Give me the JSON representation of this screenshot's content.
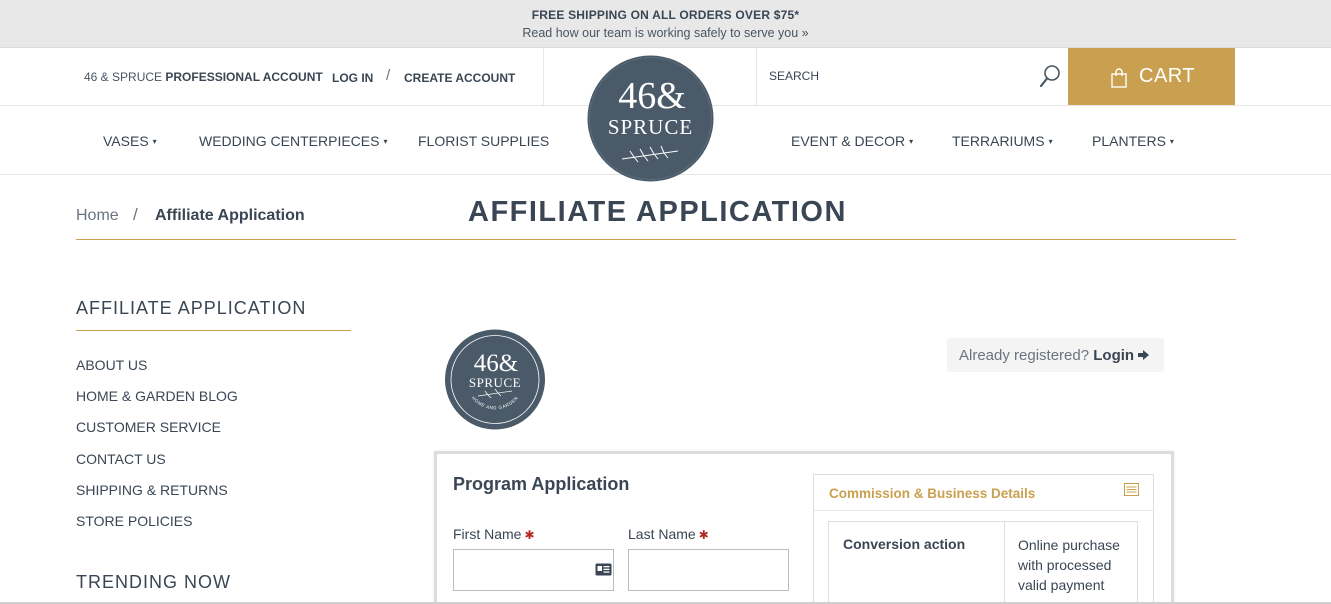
{
  "promo": {
    "line1": "FREE SHIPPING ON ALL ORDERS OVER $75*",
    "line2": "Read how our team is working safely to serve you »"
  },
  "header": {
    "account_prefix": "46 & SPRUCE",
    "account_bold": "PROFESSIONAL ACCOUNT",
    "login": "LOG IN",
    "separator": "/",
    "create_account": "CREATE ACCOUNT",
    "search_placeholder": "SEARCH",
    "cart": "CART"
  },
  "logo": {
    "line1": "46&",
    "line2": "SPRUCE",
    "ring_text": "HOME AND GARDEN"
  },
  "nav": {
    "items": [
      {
        "label": "VASES",
        "dropdown": "▾"
      },
      {
        "label": "WEDDING CENTERPIECES",
        "dropdown": "▾"
      },
      {
        "label": "FLORIST SUPPLIES",
        "dropdown": ""
      },
      {
        "label": "EVENT & DECOR",
        "dropdown": "▾"
      },
      {
        "label": "TERRARIUMS",
        "dropdown": "▾"
      },
      {
        "label": "PLANTERS",
        "dropdown": "▾"
      }
    ]
  },
  "breadcrumb": {
    "home": "Home",
    "separator": "/",
    "current": "Affiliate Application"
  },
  "page_title": "AFFILIATE APPLICATION",
  "sidebar": {
    "heading": "AFFILIATE APPLICATION",
    "links": [
      "ABOUT US",
      "HOME & GARDEN BLOG",
      "CUSTOMER SERVICE",
      "CONTACT US",
      "SHIPPING & RETURNS",
      "STORE POLICIES"
    ],
    "trending_heading": "TRENDING NOW"
  },
  "registered": {
    "text": "Already registered?",
    "login": "Login"
  },
  "form": {
    "title": "Program Application",
    "first_name_label": "First Name",
    "last_name_label": "Last Name",
    "required_mark": "✱"
  },
  "commission": {
    "heading": "Commission & Business Details",
    "rows": [
      {
        "key": "Conversion action",
        "value": "Online purchase with processed valid payment"
      }
    ]
  },
  "colors": {
    "accent_gold": "#c9a04f",
    "text_dark": "#3a4653",
    "logo_slate": "#4a5a68",
    "required_red": "#b22a1f"
  }
}
